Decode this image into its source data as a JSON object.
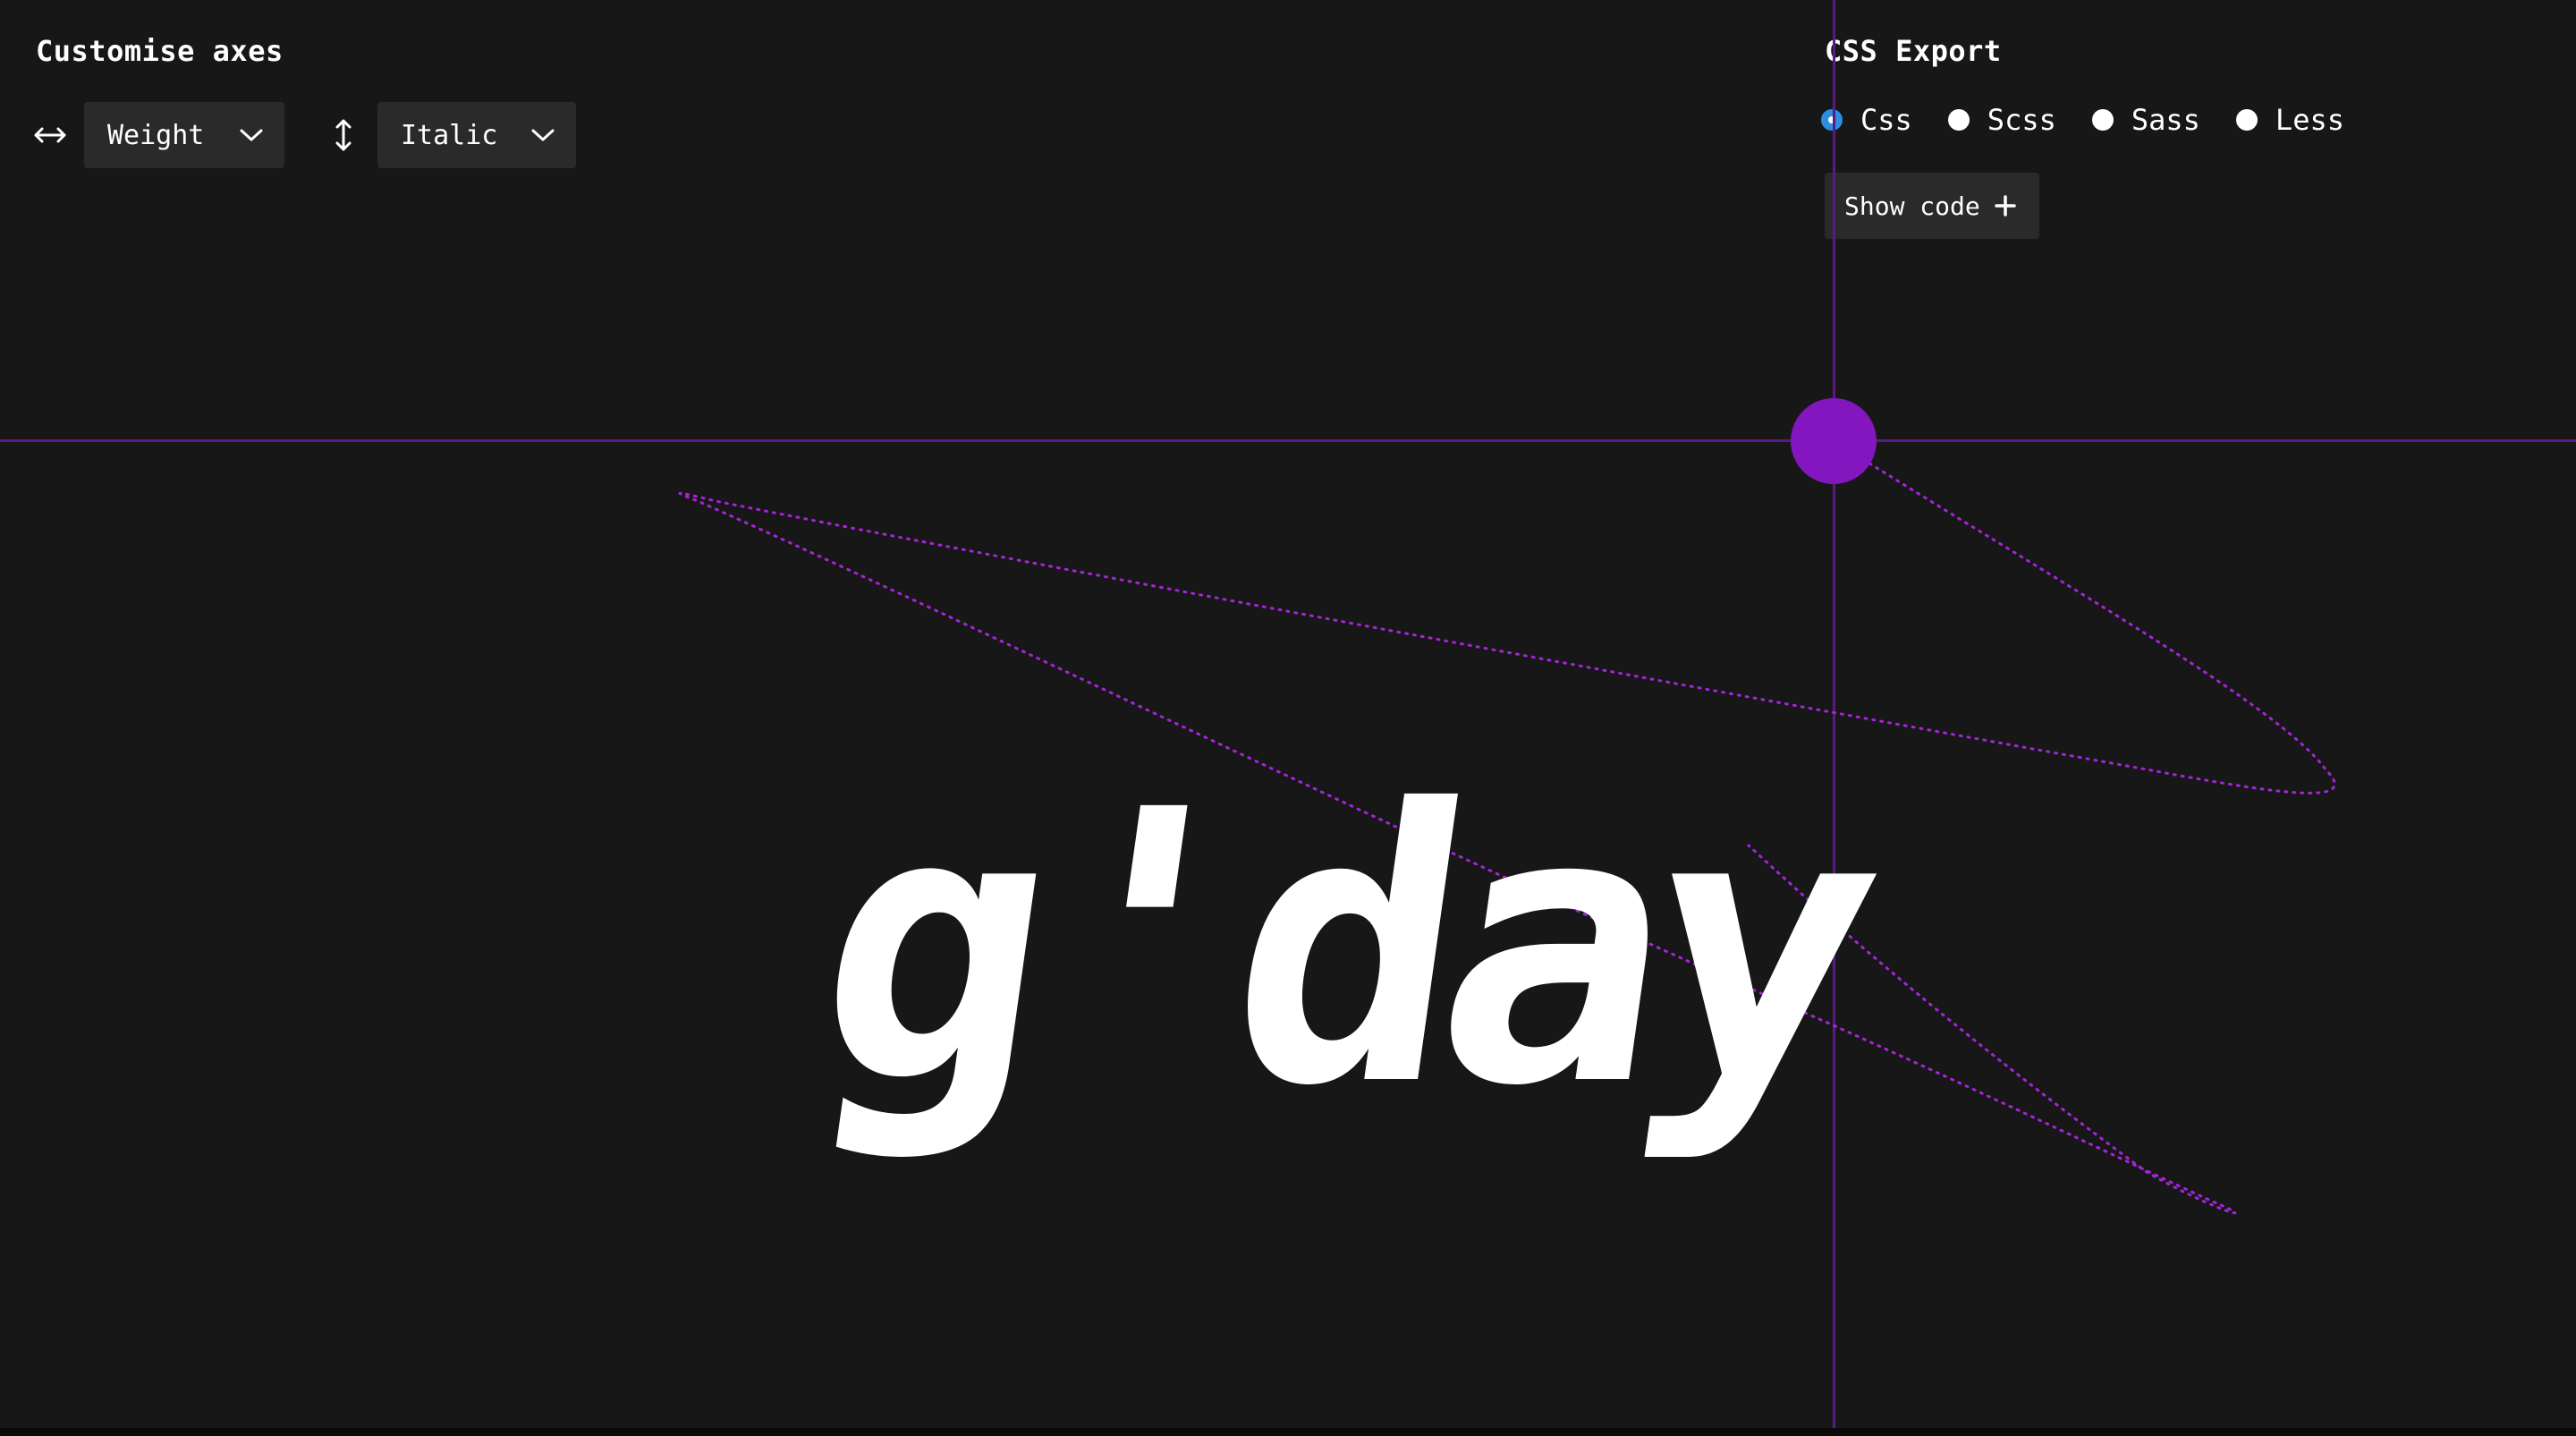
{
  "customise_axes": {
    "title": "Customise axes",
    "x_axis_icon": "horizontal-arrows-icon",
    "x_axis_selected": "Weight",
    "y_axis_icon": "vertical-arrows-icon",
    "y_axis_selected": "Italic"
  },
  "css_export": {
    "title": "CSS Export",
    "options": [
      {
        "label": "Css",
        "checked": true
      },
      {
        "label": "Scss",
        "checked": false
      },
      {
        "label": "Sass",
        "checked": false
      },
      {
        "label": "Less",
        "checked": false
      }
    ],
    "show_code_label": "Show code",
    "show_code_icon": "plus-icon"
  },
  "preview": {
    "text": "g'day"
  },
  "colors": {
    "background": "#171717",
    "control_bg": "#2a2a2a",
    "accent": "#8416bf",
    "crosshair": "#5a1a86",
    "radio_checked": "#2b8fe0",
    "text": "#ffffff"
  }
}
